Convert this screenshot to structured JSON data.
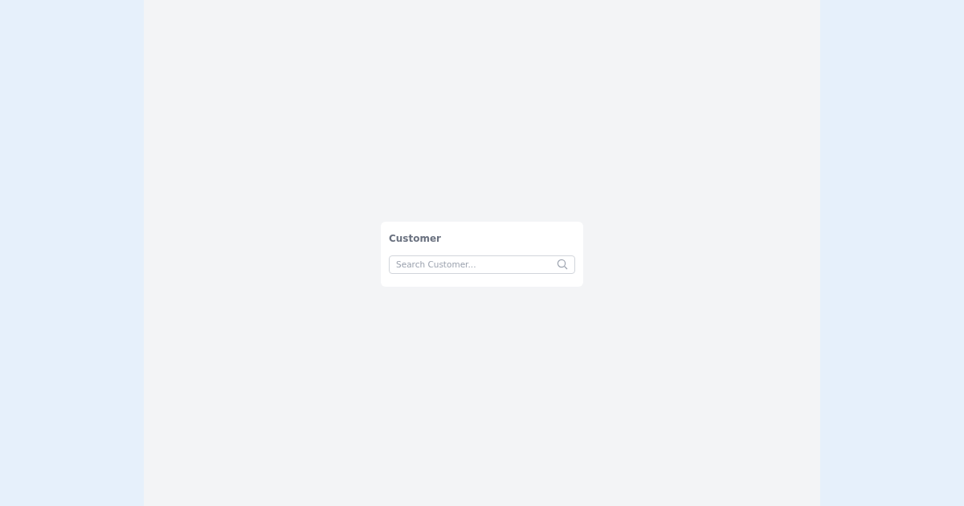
{
  "card": {
    "title": "Customer",
    "search": {
      "placeholder": "Search Customer..."
    }
  }
}
